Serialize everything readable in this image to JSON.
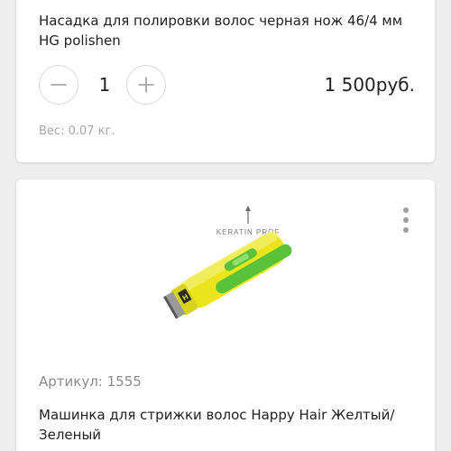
{
  "cart_item": {
    "title": "Насадка для полировки волос черная нож 46/4 мм HG polishen",
    "quantity": "1",
    "price": "1 500руб.",
    "weight": "Вес: 0.07 кг.",
    "icons": {
      "minus": "minus-icon",
      "plus": "plus-icon"
    }
  },
  "catalog_item": {
    "image_brand": "KERATIN PROF",
    "article": "Артикул: 1555",
    "title": "Машинка для стрижки волос Happy Hair Желтый/Зеленый",
    "icons": {
      "menu": "more-vertical-icon"
    }
  },
  "colors": {
    "background": "#eeeeee",
    "card": "#ffffff",
    "muted_text": "#a6a6a6",
    "button_border": "#d9d9d9",
    "product_yellow": "#e6e21a",
    "product_green": "#5cc63a"
  }
}
